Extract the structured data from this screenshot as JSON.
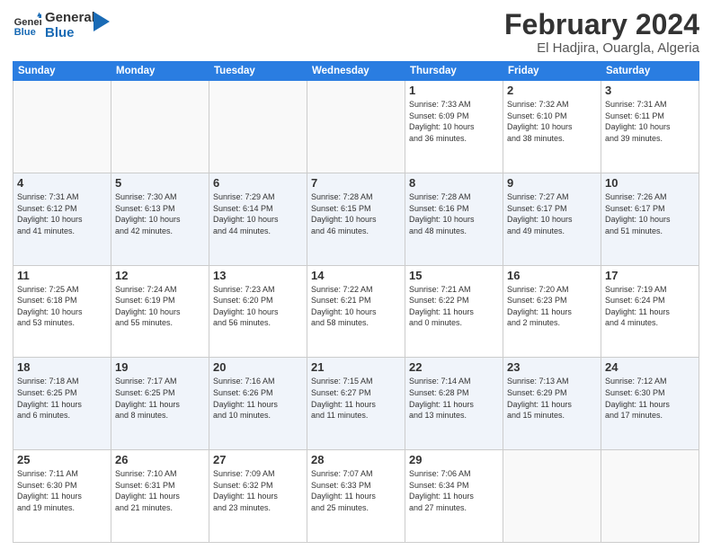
{
  "header": {
    "logo_line1": "General",
    "logo_line2": "Blue",
    "month": "February 2024",
    "location": "El Hadjira, Ouargla, Algeria"
  },
  "weekdays": [
    "Sunday",
    "Monday",
    "Tuesday",
    "Wednesday",
    "Thursday",
    "Friday",
    "Saturday"
  ],
  "weeks": [
    [
      {
        "day": "",
        "info": ""
      },
      {
        "day": "",
        "info": ""
      },
      {
        "day": "",
        "info": ""
      },
      {
        "day": "",
        "info": ""
      },
      {
        "day": "1",
        "info": "Sunrise: 7:33 AM\nSunset: 6:09 PM\nDaylight: 10 hours\nand 36 minutes."
      },
      {
        "day": "2",
        "info": "Sunrise: 7:32 AM\nSunset: 6:10 PM\nDaylight: 10 hours\nand 38 minutes."
      },
      {
        "day": "3",
        "info": "Sunrise: 7:31 AM\nSunset: 6:11 PM\nDaylight: 10 hours\nand 39 minutes."
      }
    ],
    [
      {
        "day": "4",
        "info": "Sunrise: 7:31 AM\nSunset: 6:12 PM\nDaylight: 10 hours\nand 41 minutes."
      },
      {
        "day": "5",
        "info": "Sunrise: 7:30 AM\nSunset: 6:13 PM\nDaylight: 10 hours\nand 42 minutes."
      },
      {
        "day": "6",
        "info": "Sunrise: 7:29 AM\nSunset: 6:14 PM\nDaylight: 10 hours\nand 44 minutes."
      },
      {
        "day": "7",
        "info": "Sunrise: 7:28 AM\nSunset: 6:15 PM\nDaylight: 10 hours\nand 46 minutes."
      },
      {
        "day": "8",
        "info": "Sunrise: 7:28 AM\nSunset: 6:16 PM\nDaylight: 10 hours\nand 48 minutes."
      },
      {
        "day": "9",
        "info": "Sunrise: 7:27 AM\nSunset: 6:17 PM\nDaylight: 10 hours\nand 49 minutes."
      },
      {
        "day": "10",
        "info": "Sunrise: 7:26 AM\nSunset: 6:17 PM\nDaylight: 10 hours\nand 51 minutes."
      }
    ],
    [
      {
        "day": "11",
        "info": "Sunrise: 7:25 AM\nSunset: 6:18 PM\nDaylight: 10 hours\nand 53 minutes."
      },
      {
        "day": "12",
        "info": "Sunrise: 7:24 AM\nSunset: 6:19 PM\nDaylight: 10 hours\nand 55 minutes."
      },
      {
        "day": "13",
        "info": "Sunrise: 7:23 AM\nSunset: 6:20 PM\nDaylight: 10 hours\nand 56 minutes."
      },
      {
        "day": "14",
        "info": "Sunrise: 7:22 AM\nSunset: 6:21 PM\nDaylight: 10 hours\nand 58 minutes."
      },
      {
        "day": "15",
        "info": "Sunrise: 7:21 AM\nSunset: 6:22 PM\nDaylight: 11 hours\nand 0 minutes."
      },
      {
        "day": "16",
        "info": "Sunrise: 7:20 AM\nSunset: 6:23 PM\nDaylight: 11 hours\nand 2 minutes."
      },
      {
        "day": "17",
        "info": "Sunrise: 7:19 AM\nSunset: 6:24 PM\nDaylight: 11 hours\nand 4 minutes."
      }
    ],
    [
      {
        "day": "18",
        "info": "Sunrise: 7:18 AM\nSunset: 6:25 PM\nDaylight: 11 hours\nand 6 minutes."
      },
      {
        "day": "19",
        "info": "Sunrise: 7:17 AM\nSunset: 6:25 PM\nDaylight: 11 hours\nand 8 minutes."
      },
      {
        "day": "20",
        "info": "Sunrise: 7:16 AM\nSunset: 6:26 PM\nDaylight: 11 hours\nand 10 minutes."
      },
      {
        "day": "21",
        "info": "Sunrise: 7:15 AM\nSunset: 6:27 PM\nDaylight: 11 hours\nand 11 minutes."
      },
      {
        "day": "22",
        "info": "Sunrise: 7:14 AM\nSunset: 6:28 PM\nDaylight: 11 hours\nand 13 minutes."
      },
      {
        "day": "23",
        "info": "Sunrise: 7:13 AM\nSunset: 6:29 PM\nDaylight: 11 hours\nand 15 minutes."
      },
      {
        "day": "24",
        "info": "Sunrise: 7:12 AM\nSunset: 6:30 PM\nDaylight: 11 hours\nand 17 minutes."
      }
    ],
    [
      {
        "day": "25",
        "info": "Sunrise: 7:11 AM\nSunset: 6:30 PM\nDaylight: 11 hours\nand 19 minutes."
      },
      {
        "day": "26",
        "info": "Sunrise: 7:10 AM\nSunset: 6:31 PM\nDaylight: 11 hours\nand 21 minutes."
      },
      {
        "day": "27",
        "info": "Sunrise: 7:09 AM\nSunset: 6:32 PM\nDaylight: 11 hours\nand 23 minutes."
      },
      {
        "day": "28",
        "info": "Sunrise: 7:07 AM\nSunset: 6:33 PM\nDaylight: 11 hours\nand 25 minutes."
      },
      {
        "day": "29",
        "info": "Sunrise: 7:06 AM\nSunset: 6:34 PM\nDaylight: 11 hours\nand 27 minutes."
      },
      {
        "day": "",
        "info": ""
      },
      {
        "day": "",
        "info": ""
      }
    ]
  ]
}
